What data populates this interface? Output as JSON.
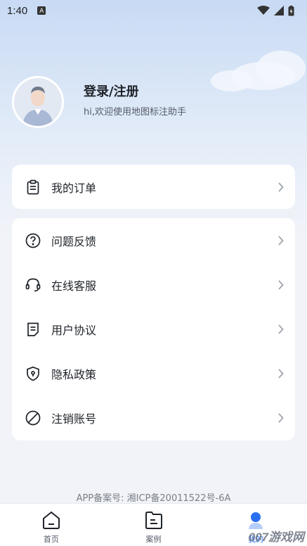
{
  "status_bar": {
    "time": "1:40",
    "notification_badge": "A"
  },
  "profile": {
    "title": "登录/注册",
    "subtitle": "hi,欢迎使用地图标注助手"
  },
  "card_orders": [
    {
      "label": "我的订单",
      "icon": "clipboard-icon"
    }
  ],
  "card_menu": [
    {
      "label": "问题反馈",
      "icon": "question-icon"
    },
    {
      "label": "在线客服",
      "icon": "headset-icon"
    },
    {
      "label": "用户协议",
      "icon": "document-icon"
    },
    {
      "label": "隐私政策",
      "icon": "shield-icon"
    },
    {
      "label": "注销账号",
      "icon": "ban-icon"
    }
  ],
  "footer": {
    "icp": "APP备案号: 湘ICP备20011522号-6A"
  },
  "bottom_nav": [
    {
      "label": "首页",
      "icon": "home-icon"
    },
    {
      "label": "案例",
      "icon": "folder-icon"
    },
    {
      "label": "我的",
      "icon": "profile-icon",
      "active": true
    }
  ],
  "watermark": "007游戏网",
  "colors": {
    "accent": "#2a6ff0",
    "background": "#f1f3f8"
  }
}
